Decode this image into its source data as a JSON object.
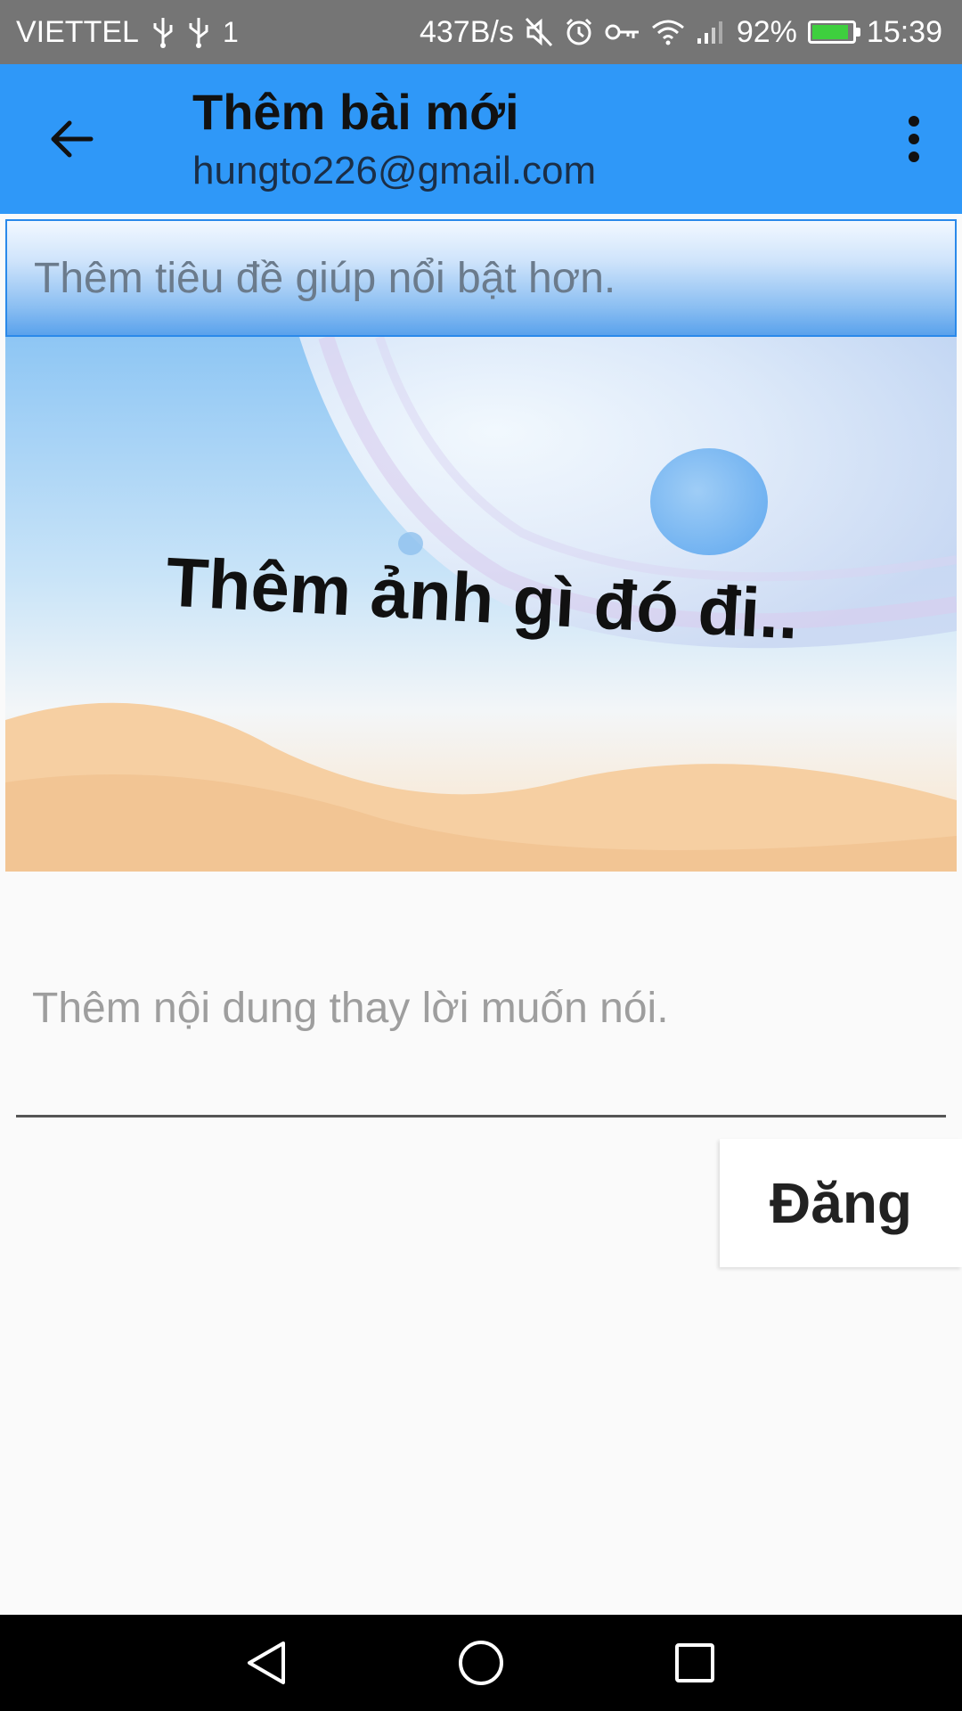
{
  "status_bar": {
    "carrier": "VIETTEL",
    "network_gen": "1",
    "speed": "437B/s",
    "battery": "92%",
    "battery_level": 0.92,
    "time": "15:39",
    "icons": [
      "usb-icon",
      "usb-icon",
      "data-icon",
      "mute-icon",
      "alarm-icon",
      "vpn-key-icon",
      "wifi-icon",
      "signal-icon",
      "battery-icon"
    ]
  },
  "app_bar": {
    "title": "Thêm bài mới",
    "subtitle": "hungto226@gmail.com",
    "back_icon": "arrow-back-icon",
    "menu_icon": "more-vertical-icon",
    "color": "#2f98f8"
  },
  "form": {
    "title_placeholder": "Thêm tiêu đề giúp nổi bật hơn.",
    "image_caption": "Thêm ảnh gì đó đi..",
    "content_placeholder": "Thêm nội dung thay lời muốn nói.",
    "post_label": "Đăng"
  },
  "nav_bar": {
    "icons": [
      "back-triangle-icon",
      "home-circle-icon",
      "recents-square-icon"
    ]
  }
}
